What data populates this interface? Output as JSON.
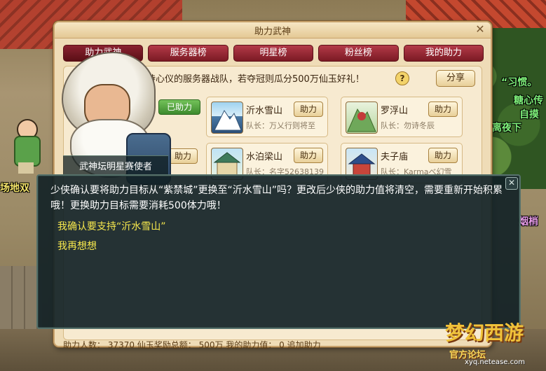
{
  "panel": {
    "title": "助力武神",
    "tabs": [
      {
        "label": "助力武神"
      },
      {
        "label": "服务器榜"
      },
      {
        "label": "明星榜"
      },
      {
        "label": "粉丝榜"
      },
      {
        "label": "我的助力"
      }
    ],
    "banner": "支持心仪的服务器战队，若夺冠则瓜分500万仙玉好礼！",
    "help_label": "?",
    "share_label": "分享",
    "assisted_label": "已助力",
    "assist_label": "助力",
    "cards": [
      {
        "name": "沂水雪山",
        "leader": "队长：万乂行则将至"
      },
      {
        "name": "罗浮山",
        "leader": "队长：勿诗冬辰"
      },
      {
        "name": "水泊梁山",
        "leader": "队长：名字52638139"
      },
      {
        "name": "夫子庙",
        "leader": "队长：Karmaべ幻雪"
      }
    ],
    "bottom_strip": "助力人数：  37370      仙玉奖励总额：  500万          我的助力值：  0              追加助力"
  },
  "npc": {
    "name": "武神坛明星赛使者"
  },
  "dialog": {
    "message": "少侠确认要将助力目标从“紫禁城”更换至“沂水雪山”吗？更改后少侠的助力值将清空，需要重新开始积累哦！更换助力目标需要消耗500体力哦！",
    "option_confirm": "我确认要支持“沂水雪山”",
    "option_cancel": "我再想想",
    "close_label": "✕"
  },
  "world": {
    "texts": [
      "“习惯。",
      "糖心传",
      "自摸",
      "离夜下",
      "场地双",
      "烟梢"
    ]
  },
  "watermark": {
    "brand": "梦幻西游",
    "subtitle": "官方论坛",
    "url": "xyq.netease.com"
  },
  "colors": {
    "tab_red": "#8a2230",
    "dialog_bg": "#12222699",
    "option_yellow": "#f7e84d",
    "assisted_green": "#3d8a2d"
  }
}
